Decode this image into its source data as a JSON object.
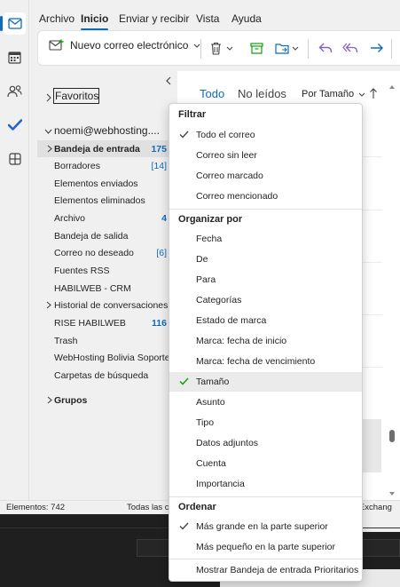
{
  "menubar": {
    "tabs": [
      {
        "label": "Archivo"
      },
      {
        "label": "Inicio"
      },
      {
        "label": "Enviar y recibir"
      },
      {
        "label": "Vista"
      },
      {
        "label": "Ayuda"
      }
    ]
  },
  "ribbon": {
    "new_mail_label": "Nuevo correo electrónico"
  },
  "folders": {
    "favorites_label": "Favoritos",
    "account": "noemi@webhosting....",
    "items": [
      {
        "label": "Bandeja de entrada",
        "count": "175"
      },
      {
        "label": "Borradores",
        "count": "[14]"
      },
      {
        "label": "Elementos enviados",
        "count": ""
      },
      {
        "label": "Elementos eliminados",
        "count": ""
      },
      {
        "label": "Archivo",
        "count": "4"
      },
      {
        "label": "Bandeja de salida",
        "count": ""
      },
      {
        "label": "Correo no deseado",
        "count": "[6]"
      },
      {
        "label": "Fuentes RSS",
        "count": ""
      },
      {
        "label": "HABILWEB - CRM",
        "count": ""
      },
      {
        "label": "Historial de conversaciones",
        "count": ""
      },
      {
        "label": "RISE HABILWEB",
        "count": "116"
      },
      {
        "label": "Trash",
        "count": ""
      },
      {
        "label": "WebHosting Bolivia Soporte",
        "count": ""
      },
      {
        "label": "Carpetas de búsqueda",
        "count": ""
      }
    ],
    "groups_label": "Grupos"
  },
  "message_list": {
    "tab_all": "Todo",
    "tab_unread": "No leídos",
    "sort_label": "Por Tamaño"
  },
  "status": {
    "elements": "Elementos: 742",
    "middle": "Todas las c",
    "right": "ft Exchang"
  },
  "dropdown": {
    "filter_heading": "Filtrar",
    "filter_items": [
      {
        "label": "Todo el correo",
        "checked": true
      },
      {
        "label": "Correo sin leer",
        "checked": false
      },
      {
        "label": "Correo marcado",
        "checked": false
      },
      {
        "label": "Correo mencionado",
        "checked": false
      }
    ],
    "organize_heading": "Organizar por",
    "organize_items": [
      {
        "label": "Fecha",
        "checked": false
      },
      {
        "label": "De",
        "checked": false
      },
      {
        "label": "Para",
        "checked": false
      },
      {
        "label": "Categorías",
        "checked": false
      },
      {
        "label": "Estado de marca",
        "checked": false
      },
      {
        "label": "Marca: fecha de inicio",
        "checked": false
      },
      {
        "label": "Marca: fecha de vencimiento",
        "checked": false
      },
      {
        "label": "Tamaño",
        "checked": true
      },
      {
        "label": "Asunto",
        "checked": false
      },
      {
        "label": "Tipo",
        "checked": false
      },
      {
        "label": "Datos adjuntos",
        "checked": false
      },
      {
        "label": "Cuenta",
        "checked": false
      },
      {
        "label": "Importancia",
        "checked": false
      }
    ],
    "order_heading": "Ordenar",
    "order_items": [
      {
        "label": "Más grande en la parte superior",
        "checked": true
      },
      {
        "label": "Más pequeño en la parte superior",
        "checked": false
      }
    ],
    "focused_label": "Mostrar Bandeja de entrada Prioritarios"
  },
  "colors": {
    "accent": "#0f6cbd",
    "check_green": "#13a10e"
  }
}
